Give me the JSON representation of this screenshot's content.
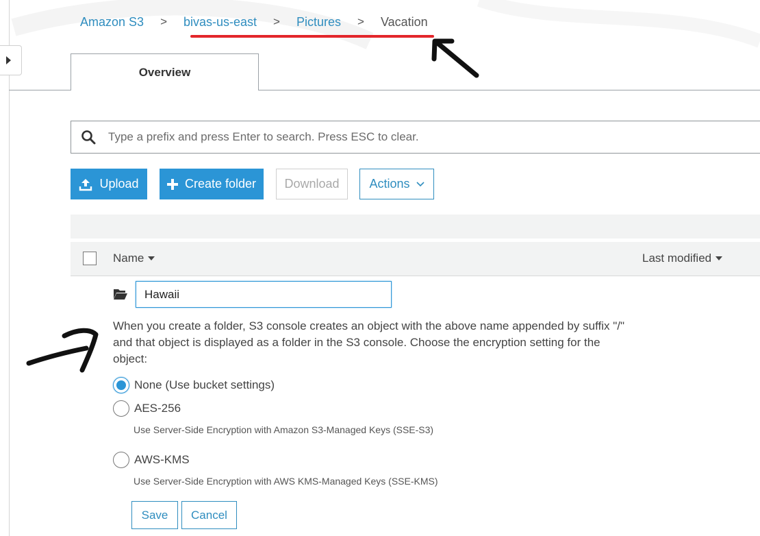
{
  "breadcrumb": {
    "items": [
      {
        "label": "Amazon S3"
      },
      {
        "label": "bivas-us-east"
      },
      {
        "label": "Pictures"
      }
    ],
    "current": "Vacation",
    "separator": ">"
  },
  "tabs": {
    "overview": "Overview"
  },
  "search": {
    "placeholder": "Type a prefix and press Enter to search. Press ESC to clear.",
    "value": ""
  },
  "toolbar": {
    "upload_label": "Upload",
    "create_folder_label": "Create folder",
    "download_label": "Download",
    "actions_label": "Actions"
  },
  "table": {
    "columns": {
      "name": "Name",
      "last_modified": "Last modified"
    }
  },
  "new_folder": {
    "name_value": "Hawaii",
    "help_text": "When you create a folder, S3 console creates an object with the above name appended by suffix \"/\" and that object is displayed as a folder in the S3 console. Choose the encryption setting for the object:",
    "encryption_options": [
      {
        "label": "None (Use bucket settings)",
        "description": "",
        "selected": true
      },
      {
        "label": "AES-256",
        "description": "Use Server-Side Encryption with Amazon S3-Managed Keys (SSE-S3)",
        "selected": false
      },
      {
        "label": "AWS-KMS",
        "description": "Use Server-Side Encryption with AWS KMS-Managed Keys (SSE-KMS)",
        "selected": false
      }
    ],
    "save_label": "Save",
    "cancel_label": "Cancel"
  },
  "colors": {
    "link": "#2f8dbf",
    "primary": "#2b95d6",
    "annotation_red": "#e3262b",
    "annotation_black": "#111111"
  },
  "icons": {
    "search": "search-icon",
    "upload": "upload-icon",
    "create": "plus-icon",
    "actions_caret": "chevron-down-icon",
    "folder": "folder-open-icon",
    "rail_toggle": "caret-right-icon"
  }
}
